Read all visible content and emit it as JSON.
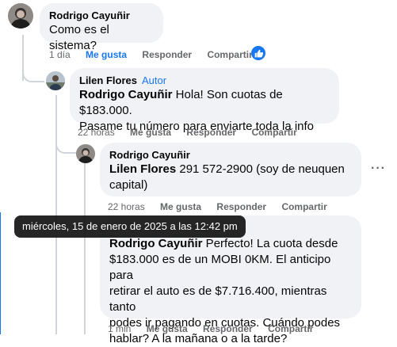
{
  "comments": [
    {
      "author": "Rodrigo Cayuñir",
      "text": "Como es el sistema?",
      "time": "1 día",
      "like": "Me gusta",
      "reply": "Responder",
      "share": "Compartir"
    },
    {
      "author": "Lilen Flores",
      "tag": "Autor",
      "mention": "Rodrigo Cayuñir",
      "text_line1_rest": " Hola! Son cuotas de $183.000.",
      "text_line2": "Pasame tu número para enviarte toda la info",
      "time": "22 horas",
      "like": "Me gusta",
      "reply": "Responder",
      "share": "Compartir"
    },
    {
      "author": "Rodrigo Cayuñir",
      "mention": "Lilen Flores",
      "text_line1_rest": " 291 572-2900 (soy de neuquen",
      "text_line2": "capital)",
      "time": "22 horas",
      "like": "Me gusta",
      "reply": "Responder",
      "share": "Compartir"
    },
    {
      "mention": "Rodrigo Cayuñir",
      "text_line1_rest": " Perfecto! La cuota desde",
      "text_line2": "$183.000 es de un MOBI 0KM. El anticipo para",
      "text_line3": "retirar el auto es de $7.716.400, mientras tanto",
      "text_line4": "podes ir pagando en cuotas. Cuándo podes",
      "text_line5": "hablar? A la mañana o a la tarde?",
      "time": "1 min",
      "like": "Me gusta",
      "reply": "Responder",
      "share": "Compartir"
    }
  ],
  "tooltip": "miércoles, 15 de enero de 2025 a las 12:42 pm",
  "colors": {
    "accent": "#1877f2",
    "bubble": "#f0f2f5",
    "muted": "#65676b"
  }
}
